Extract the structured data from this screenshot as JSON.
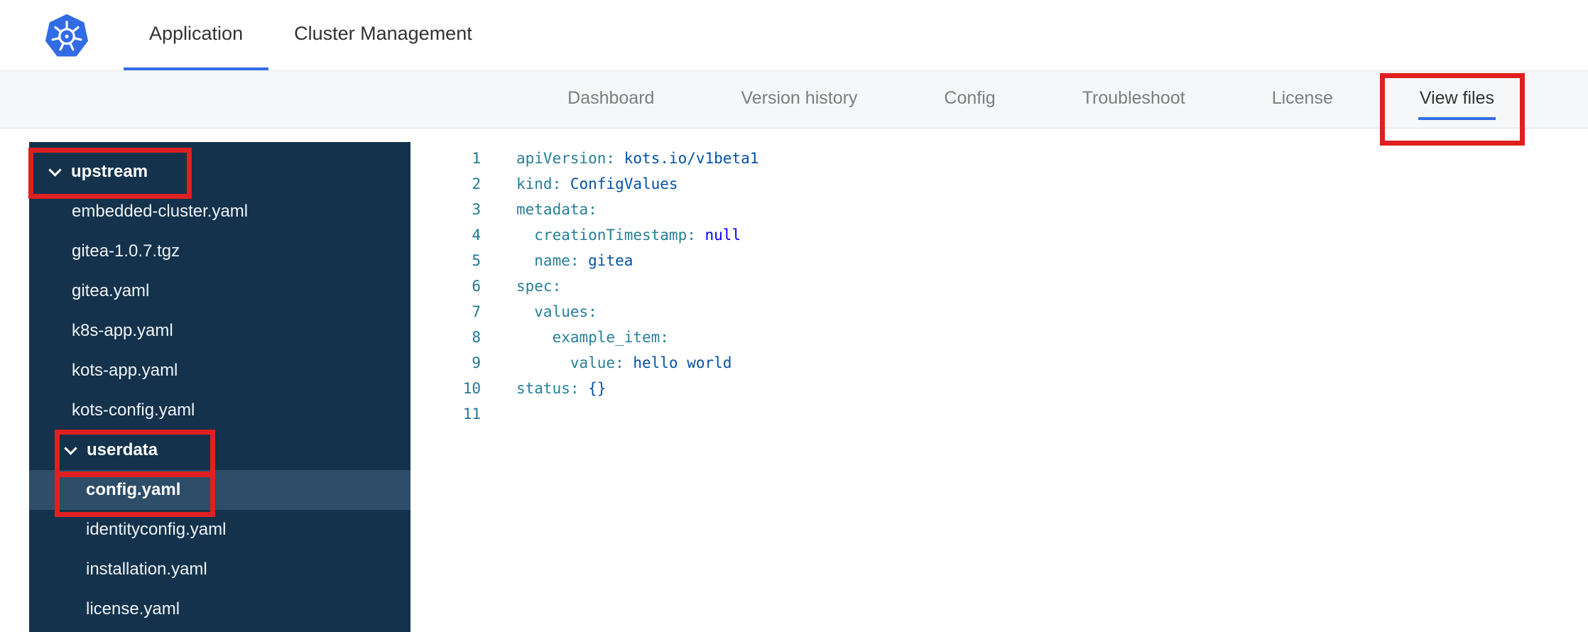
{
  "header": {
    "tabs": [
      {
        "label": "Application",
        "active": true
      },
      {
        "label": "Cluster Management",
        "active": false
      }
    ]
  },
  "subnav": {
    "items": [
      {
        "label": "Dashboard",
        "active": false
      },
      {
        "label": "Version history",
        "active": false
      },
      {
        "label": "Config",
        "active": false
      },
      {
        "label": "Troubleshoot",
        "active": false
      },
      {
        "label": "License",
        "active": false
      },
      {
        "label": "View files",
        "active": true
      }
    ]
  },
  "file_tree": {
    "groups": [
      {
        "label": "upstream",
        "expanded": true,
        "files": [
          "embedded-cluster.yaml",
          "gitea-1.0.7.tgz",
          "gitea.yaml",
          "k8s-app.yaml",
          "kots-app.yaml",
          "kots-config.yaml"
        ]
      },
      {
        "label": "userdata",
        "expanded": true,
        "selected_file": "config.yaml",
        "files": [
          "config.yaml",
          "identityconfig.yaml",
          "installation.yaml",
          "license.yaml"
        ]
      }
    ]
  },
  "editor": {
    "language": "yaml",
    "lines": [
      {
        "num": "1",
        "tokens": [
          {
            "text": "apiVersion:",
            "type": "key"
          },
          {
            "text": " kots.io/v1beta1",
            "type": "val"
          }
        ]
      },
      {
        "num": "2",
        "tokens": [
          {
            "text": "kind:",
            "type": "key"
          },
          {
            "text": " ConfigValues",
            "type": "val"
          }
        ]
      },
      {
        "num": "3",
        "tokens": [
          {
            "text": "metadata:",
            "type": "key"
          }
        ]
      },
      {
        "num": "4",
        "tokens": [
          {
            "text": "  creationTimestamp:",
            "type": "key"
          },
          {
            "text": " null",
            "type": "kw"
          }
        ]
      },
      {
        "num": "5",
        "tokens": [
          {
            "text": "  name:",
            "type": "key"
          },
          {
            "text": " gitea",
            "type": "val"
          }
        ]
      },
      {
        "num": "6",
        "tokens": [
          {
            "text": "spec:",
            "type": "key"
          }
        ]
      },
      {
        "num": "7",
        "tokens": [
          {
            "text": "  values:",
            "type": "key"
          }
        ]
      },
      {
        "num": "8",
        "tokens": [
          {
            "text": "    example_item:",
            "type": "key"
          }
        ]
      },
      {
        "num": "9",
        "tokens": [
          {
            "text": "      value:",
            "type": "key"
          },
          {
            "text": " hello world",
            "type": "val"
          }
        ]
      },
      {
        "num": "10",
        "tokens": [
          {
            "text": "status:",
            "type": "key"
          },
          {
            "text": " {}",
            "type": "val"
          }
        ]
      },
      {
        "num": "11",
        "tokens": []
      }
    ]
  },
  "annotations": {
    "color": "#e02020",
    "targets": [
      "view-files-tab",
      "upstream-group",
      "userdata-group",
      "config-yaml-file"
    ]
  },
  "colors": {
    "accent_blue": "#326de6",
    "subnav_bg": "#f5f7f8",
    "sidebar_bg": "#14324b",
    "sidebar_selected": "#2d4d69",
    "code_key": "#267f99",
    "code_value": "#0451a5",
    "code_keyword": "#0000ff",
    "line_number": "#237893",
    "logo_blue": "#326ce5"
  }
}
